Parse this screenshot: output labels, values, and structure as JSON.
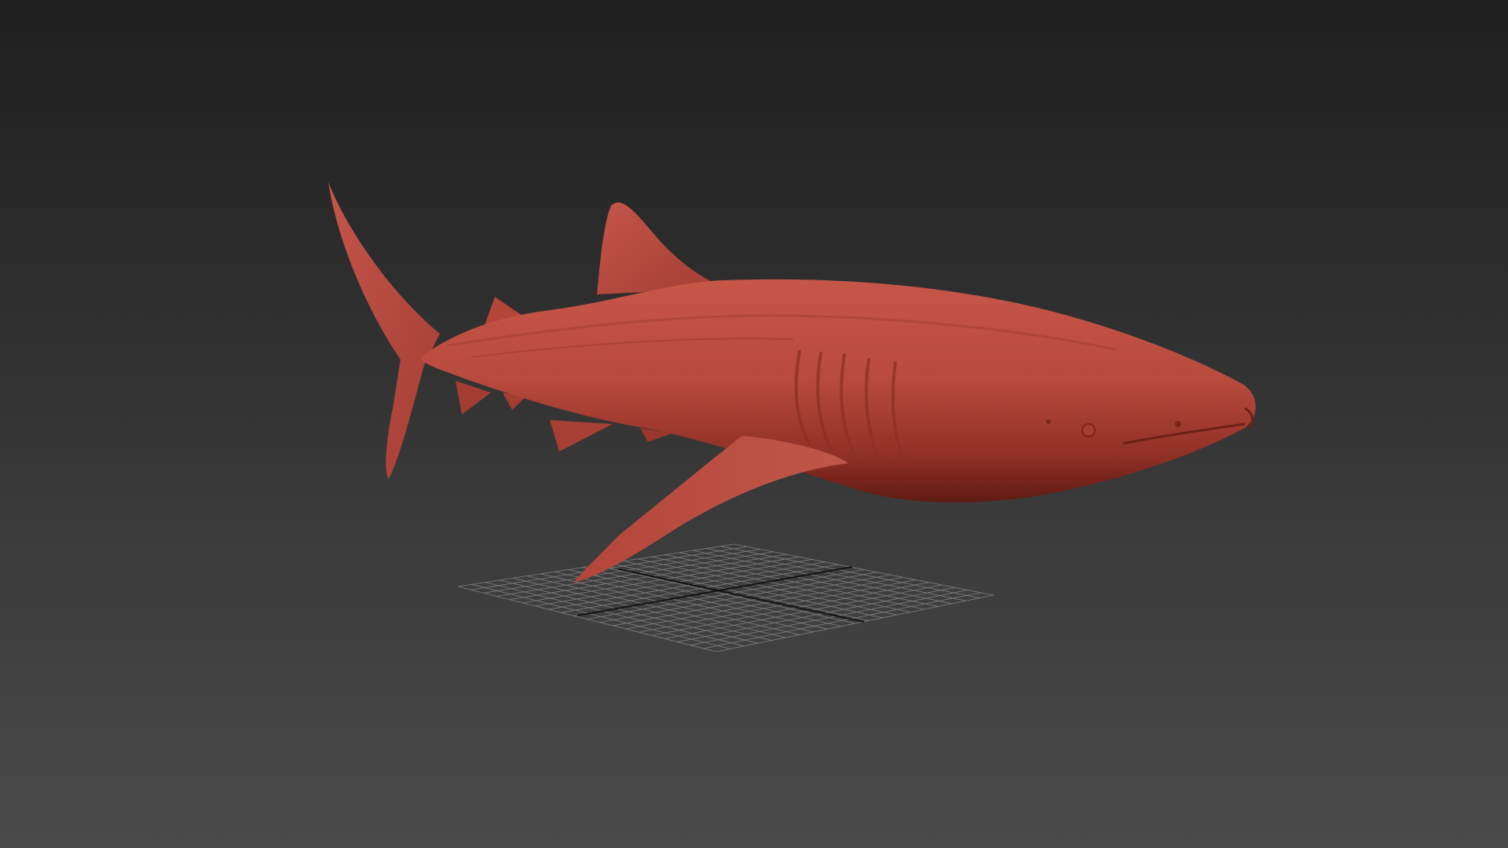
{
  "viewport": {
    "object": "whale-shark-model",
    "model_color": "#b84a3e",
    "background_top": "#1f1f1f",
    "background_bottom": "#4a4a4a",
    "grid_color": "#8a8a8a",
    "grid_axis_color": "#111111"
  }
}
